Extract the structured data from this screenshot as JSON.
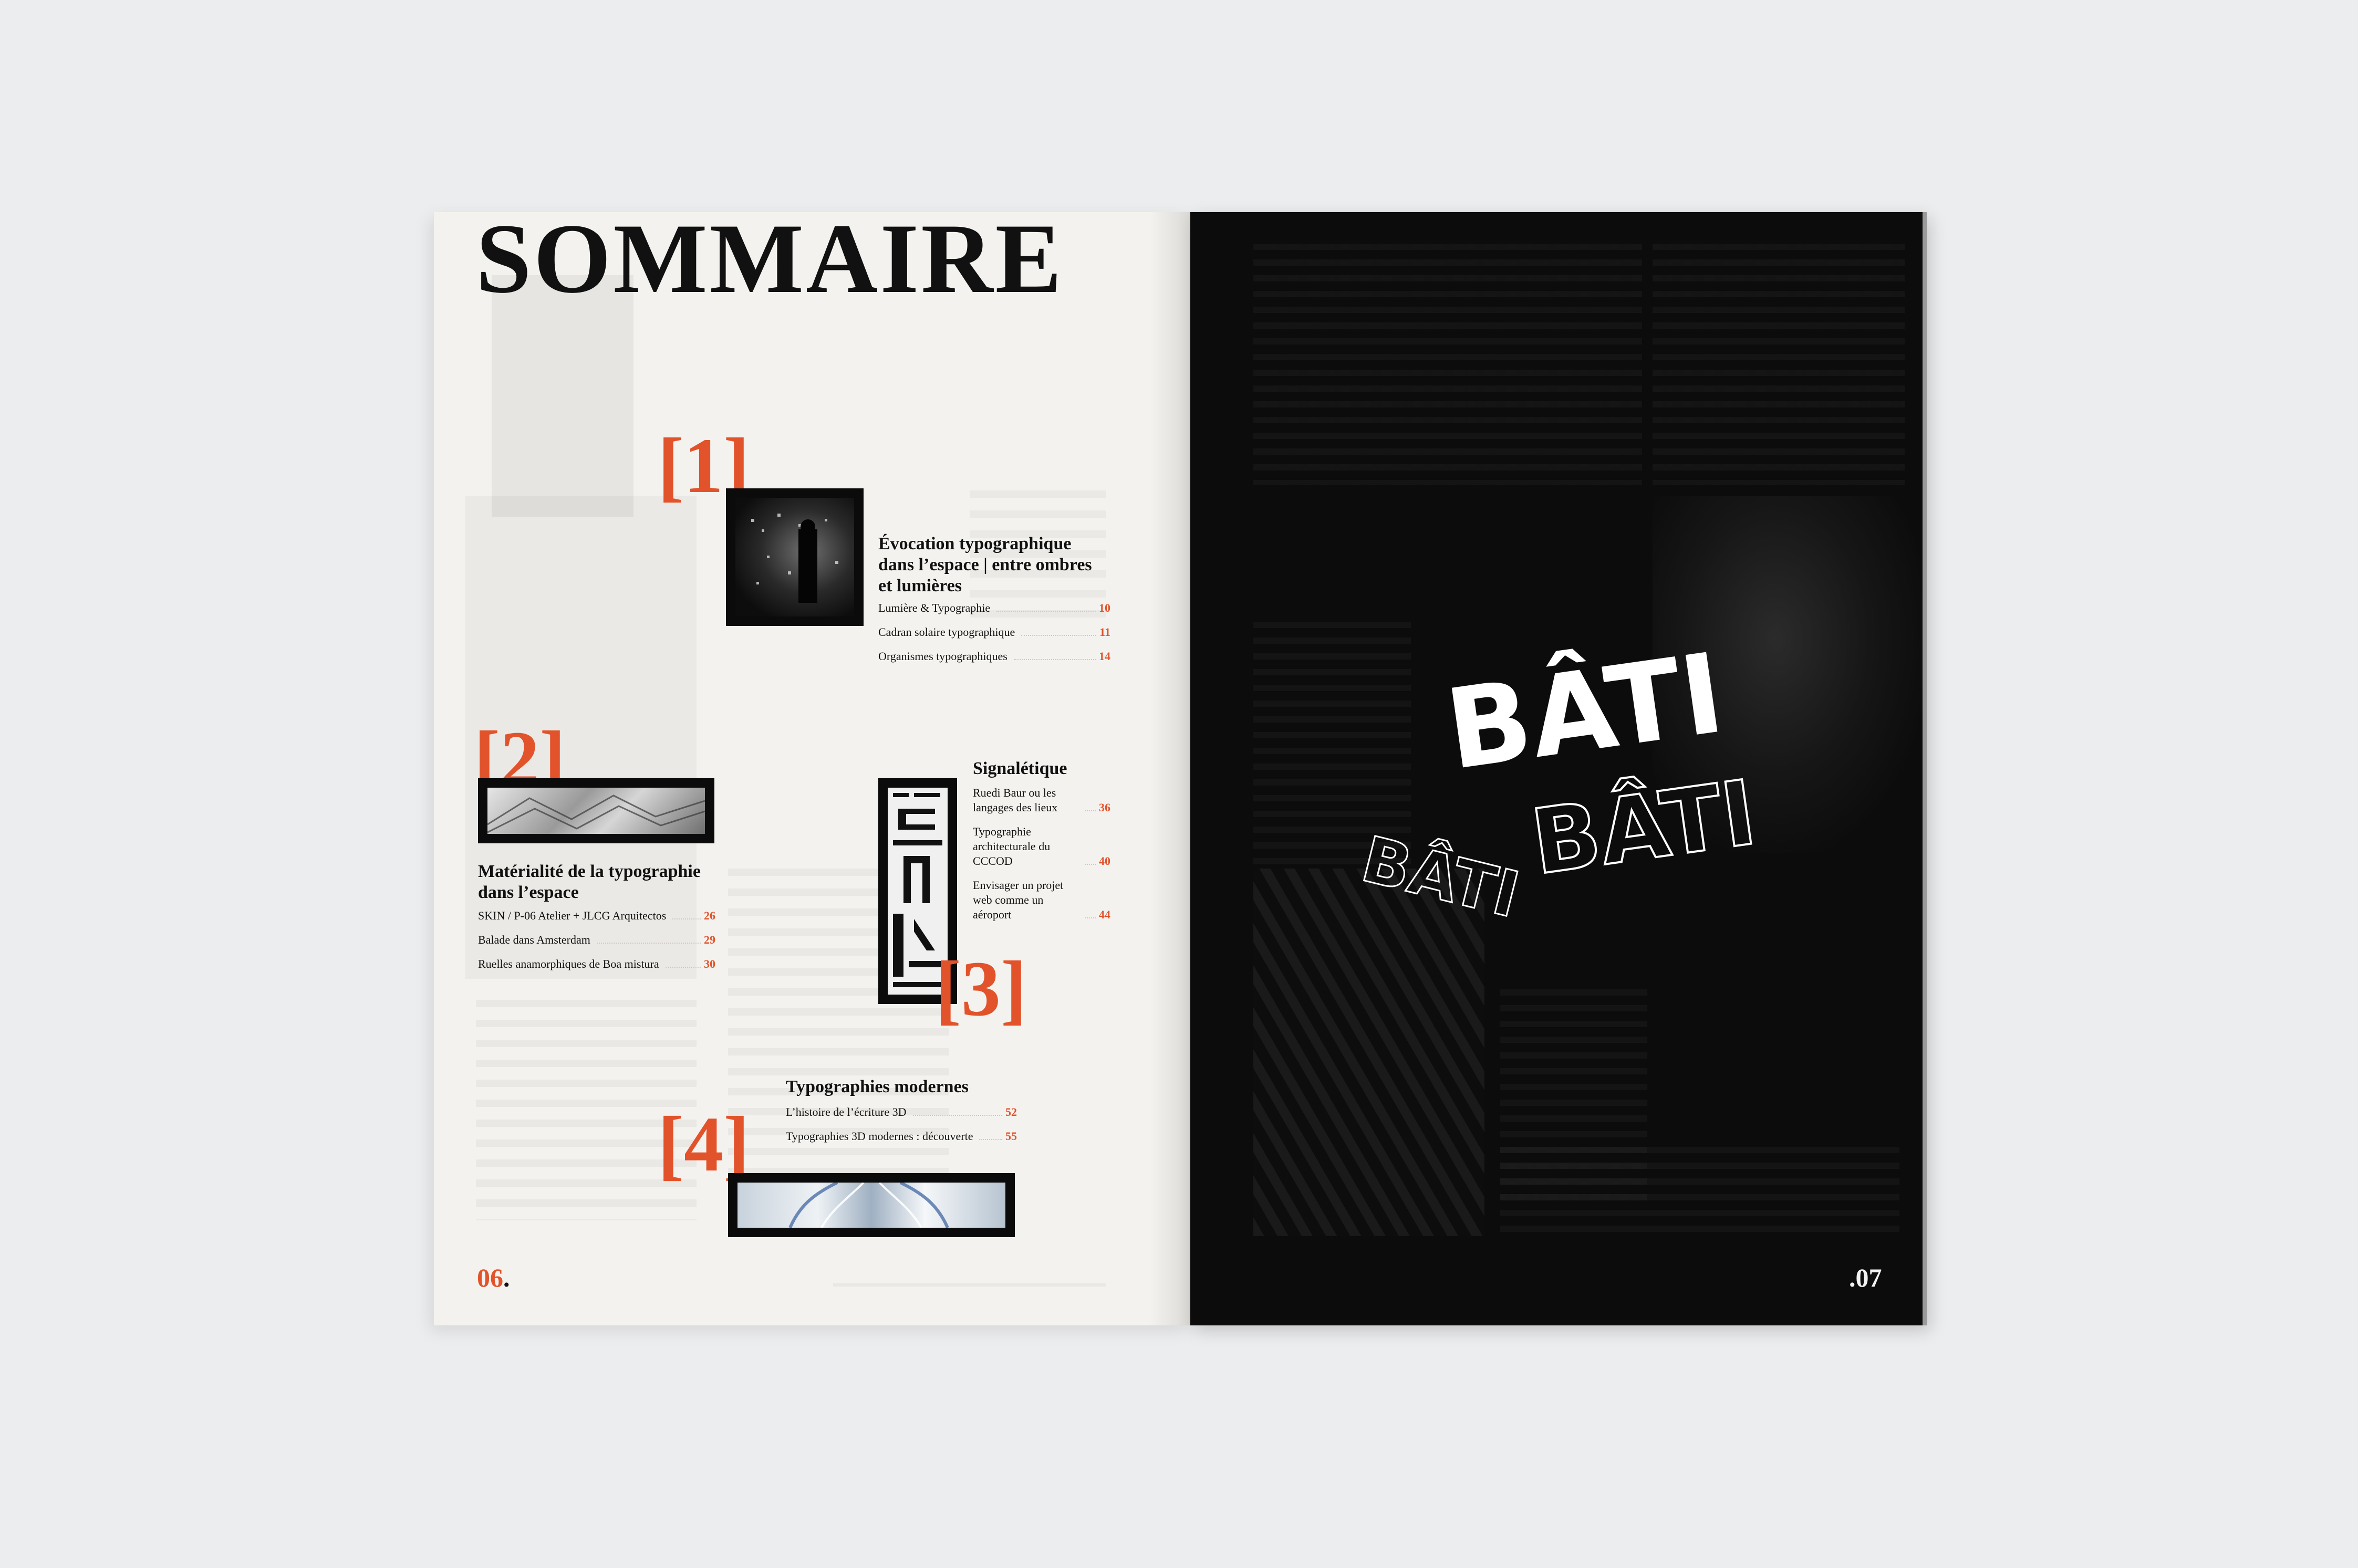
{
  "title": "SOMMAIRE",
  "sections": [
    {
      "number": "[1]",
      "title": "Évocation typographique dans l’espace | entre ombres et lumières",
      "items": [
        {
          "label": "Lumière & Typographie",
          "page": "10"
        },
        {
          "label": "Cadran solaire typographique",
          "page": "11"
        },
        {
          "label": "Organismes typographiques",
          "page": "14"
        }
      ]
    },
    {
      "number": "[2]",
      "title": "Matérialité de la typographie dans l’espace",
      "items": [
        {
          "label": "SKIN / P-06 Atelier + JLCG Arquitectos",
          "page": "26"
        },
        {
          "label": "Balade dans Amsterdam",
          "page": "29"
        },
        {
          "label": "Ruelles anamorphiques de Boa mistura",
          "page": "30"
        }
      ]
    },
    {
      "number": "[3]",
      "title": "Signalétique",
      "items": [
        {
          "label": "Ruedi Baur ou les langages des lieux",
          "page": "36"
        },
        {
          "label": "Typographie architecturale du CCCOD",
          "page": "40"
        },
        {
          "label": "Envisager un projet web comme un aéroport",
          "page": "44"
        }
      ]
    },
    {
      "number": "[4]",
      "title": "Typographies modernes",
      "items": [
        {
          "label": "L’histoire de l’écriture 3D",
          "page": "52"
        },
        {
          "label": "Typographies 3D modernes : découverte",
          "page": "55"
        }
      ]
    }
  ],
  "folio_left": {
    "number": "06",
    "dot": "."
  },
  "folio_right": {
    "dot": ".",
    "number": "07"
  },
  "ring_word": "BÂTI",
  "colors": {
    "accent": "#e2532b",
    "paper": "#f4f2ee",
    "ink": "#111111",
    "dark_page": "#0c0c0c"
  }
}
